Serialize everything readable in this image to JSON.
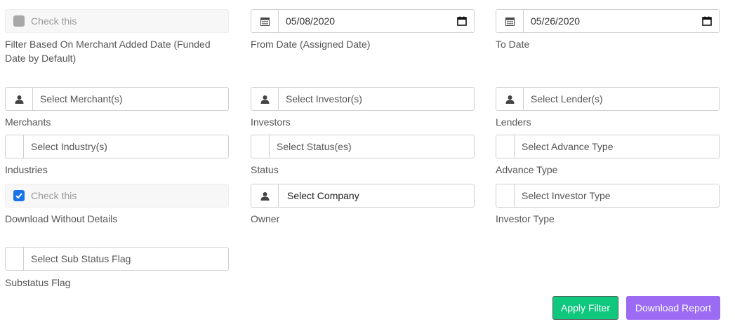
{
  "row1": {
    "checkbox_text": "Check this",
    "checkbox_label": "Filter Based On Merchant Added Date (Funded Date by Default)",
    "from_date_value": "05/08/2020",
    "from_date_label": "From Date (Assigned Date)",
    "to_date_value": "05/26/2020",
    "to_date_label": "To Date"
  },
  "row2": {
    "merchant_placeholder": "Select Merchant(s)",
    "merchant_label": "Merchants",
    "investor_placeholder": "Select Investor(s)",
    "investor_label": "Investors",
    "lender_placeholder": "Select Lender(s)",
    "lender_label": "Lenders"
  },
  "row3": {
    "industry_placeholder": "Select Industry(s)",
    "industry_label": "Industries",
    "status_placeholder": "Select Status(es)",
    "status_label": "Status",
    "advance_placeholder": "Select Advance Type",
    "advance_label": "Advance Type"
  },
  "row4": {
    "checkbox_text": "Check this",
    "checkbox_label": "Download Without Details",
    "company_value": "Select Company",
    "company_label": "Owner",
    "investor_type_placeholder": "Select Investor Type",
    "investor_type_label": "Investor Type"
  },
  "row5": {
    "substatus_placeholder": "Select Sub Status Flag",
    "substatus_label": "Substatus Flag"
  },
  "buttons": {
    "apply": "Apply Filter",
    "download": "Download Report"
  },
  "colors": {
    "apply_bg": "#10c77e",
    "download_bg": "#9b6bf3",
    "checkbox_checked": "#1a73e8"
  },
  "checkboxes": {
    "filter_by_added_date": false,
    "download_without_details": true
  }
}
